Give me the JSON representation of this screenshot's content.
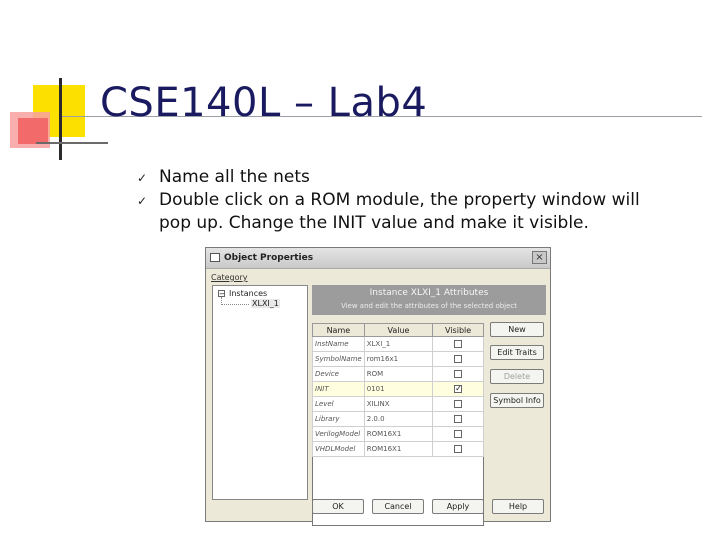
{
  "slide": {
    "title": "CSE140L – Lab4",
    "bullets": [
      "Name all the nets",
      "Double click on a ROM module, the property window will pop up. Change the INIT value and make it visible."
    ],
    "bullet_icon": "check-icon"
  },
  "dialog": {
    "title": "Object Properties",
    "close_glyph": "×",
    "category_label": "Category",
    "tree": {
      "expander": "−",
      "root": "Instances",
      "child": "XLXI_1"
    },
    "header": {
      "title": "Instance XLXI_1 Attributes",
      "subtitle": "View and edit the attributes of the selected object"
    },
    "columns": [
      "Name",
      "Value",
      "Visible"
    ],
    "rows": [
      {
        "name": "InstName",
        "value": "XLXI_1",
        "visible": false
      },
      {
        "name": "SymbolName",
        "value": "rom16x1",
        "visible": false
      },
      {
        "name": "Device",
        "value": "ROM",
        "visible": false
      },
      {
        "name": "INIT",
        "value": "0101",
        "visible": true
      },
      {
        "name": "Level",
        "value": "XILINX",
        "visible": false
      },
      {
        "name": "Library",
        "value": "2.0.0",
        "visible": false
      },
      {
        "name": "VerilogModel",
        "value": "ROM16X1",
        "visible": false
      },
      {
        "name": "VHDLModel",
        "value": "ROM16X1",
        "visible": false
      }
    ],
    "side_buttons": {
      "new": "New",
      "edit_traits": "Edit Traits",
      "delete": "Delete",
      "symbol_info": "Symbol Info"
    },
    "bottom_buttons": {
      "ok": "OK",
      "cancel": "Cancel",
      "apply": "Apply",
      "help": "Help"
    },
    "checkmark": "✓"
  }
}
